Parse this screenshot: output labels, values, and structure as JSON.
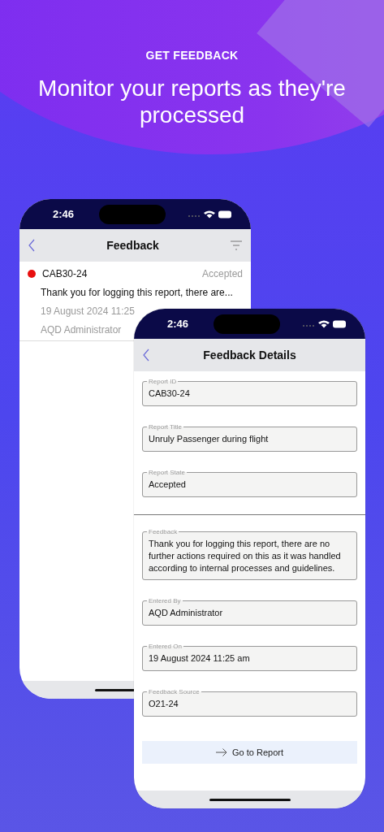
{
  "header": {
    "eyebrow": "GET FEEDBACK",
    "headline": "Monitor your reports as they're processed"
  },
  "list_screen": {
    "status_bar": {
      "time": "2:46"
    },
    "nav_title": "Feedback",
    "items": [
      {
        "report_id": "CAB30-24",
        "status": "Accepted",
        "color": "#e8100f",
        "summary": "Thank you for logging this report, there are...",
        "date": "19 August 2024 11:25",
        "author": "AQD Administrator"
      }
    ]
  },
  "detail_screen": {
    "status_bar": {
      "time": "2:46"
    },
    "nav_title": "Feedback Details",
    "report_fields": [
      {
        "label": "Report ID",
        "value": "CAB30-24"
      },
      {
        "label": "Report Title",
        "value": "Unruly Passenger during flight"
      },
      {
        "label": "Report State",
        "value": "Accepted"
      }
    ],
    "feedback_fields": [
      {
        "label": "Feedback",
        "value": "Thank you for logging this report, there are no further actions required on this as it was handled according to internal processes and guidelines."
      },
      {
        "label": "Entered By",
        "value": "AQD Administrator"
      },
      {
        "label": "Entered On",
        "value": "19 August 2024 11:25 am"
      },
      {
        "label": "Feedback Source",
        "value": "O21-24"
      }
    ],
    "action": {
      "label": "Go to Report"
    }
  }
}
